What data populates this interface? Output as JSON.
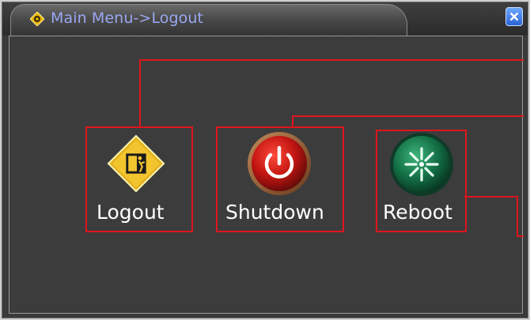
{
  "window": {
    "title": "Main Menu->Logout"
  },
  "menu": {
    "items": [
      {
        "label": "Logout",
        "icon": "logout-icon"
      },
      {
        "label": "Shutdown",
        "icon": "power-icon"
      },
      {
        "label": "Reboot",
        "icon": "reboot-icon"
      }
    ]
  },
  "colors": {
    "title_text": "#9aa7f2",
    "highlight_border": "#e0141e",
    "background": "#3c3c3c"
  }
}
